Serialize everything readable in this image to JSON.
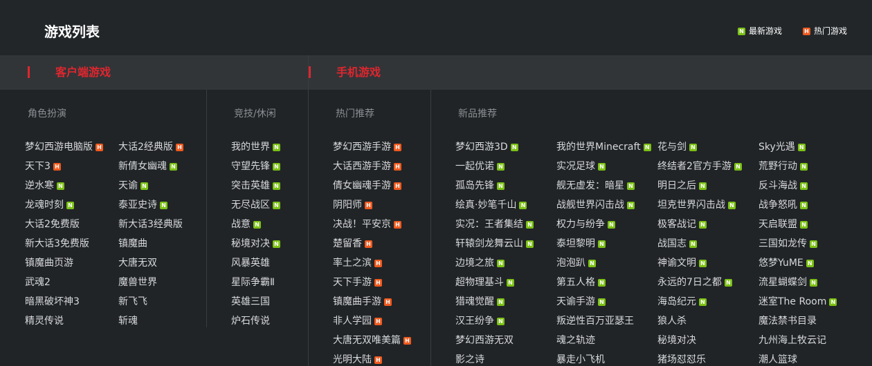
{
  "header": {
    "title": "游戏列表",
    "legend_new": "最新游戏",
    "legend_hot": "热门游戏",
    "badge_new": "N",
    "badge_hot": "H"
  },
  "categories": {
    "client": "客户端游戏",
    "mobile": "手机游戏"
  },
  "columns": [
    {
      "title": "角色扮演",
      "games": [
        {
          "name": "梦幻西游电脑版",
          "tag": "hot"
        },
        {
          "name": "天下3",
          "tag": "hot"
        },
        {
          "name": "逆水寒",
          "tag": "new"
        },
        {
          "name": "龙魂时刻",
          "tag": "new"
        },
        {
          "name": "大话2免费版",
          "tag": ""
        },
        {
          "name": "新大话3免费版",
          "tag": ""
        },
        {
          "name": "镇魔曲页游",
          "tag": ""
        },
        {
          "name": "武魂2",
          "tag": ""
        },
        {
          "name": "暗黑破坏神3",
          "tag": ""
        },
        {
          "name": "精灵传说",
          "tag": ""
        }
      ]
    },
    {
      "title": "",
      "games": [
        {
          "name": "大话2经典版",
          "tag": "hot"
        },
        {
          "name": "新倩女幽魂",
          "tag": "new"
        },
        {
          "name": "天谕",
          "tag": "new"
        },
        {
          "name": "泰亚史诗",
          "tag": "new"
        },
        {
          "name": "新大话3经典版",
          "tag": ""
        },
        {
          "name": "镇魔曲",
          "tag": ""
        },
        {
          "name": "大唐无双",
          "tag": ""
        },
        {
          "name": "魔兽世界",
          "tag": ""
        },
        {
          "name": "新飞飞",
          "tag": ""
        },
        {
          "name": "斩魂",
          "tag": ""
        }
      ]
    },
    {
      "title": "竞技/休闲",
      "games": [
        {
          "name": "我的世界",
          "tag": "new"
        },
        {
          "name": "守望先锋",
          "tag": "new"
        },
        {
          "name": "突击英雄",
          "tag": "new"
        },
        {
          "name": "无尽战区",
          "tag": "new"
        },
        {
          "name": "战意",
          "tag": "new"
        },
        {
          "name": "秘境对决",
          "tag": "new"
        },
        {
          "name": "风暴英雄",
          "tag": ""
        },
        {
          "name": "星际争霸Ⅱ",
          "tag": ""
        },
        {
          "name": "英雄三国",
          "tag": ""
        },
        {
          "name": "炉石传说",
          "tag": ""
        }
      ]
    },
    {
      "title": "热门推荐",
      "games": [
        {
          "name": "梦幻西游手游",
          "tag": "hot"
        },
        {
          "name": "大话西游手游",
          "tag": "hot"
        },
        {
          "name": "倩女幽魂手游",
          "tag": "hot"
        },
        {
          "name": "阴阳师",
          "tag": "hot"
        },
        {
          "name": "决战！平安京",
          "tag": "hot"
        },
        {
          "name": "楚留香",
          "tag": "hot"
        },
        {
          "name": "率土之滨",
          "tag": "hot"
        },
        {
          "name": "天下手游",
          "tag": "hot"
        },
        {
          "name": "镇魔曲手游",
          "tag": "hot"
        },
        {
          "name": "非人学园",
          "tag": "hot"
        },
        {
          "name": "大唐无双唯美篇",
          "tag": "hot"
        },
        {
          "name": "光明大陆",
          "tag": "hot"
        }
      ]
    },
    {
      "title": "新品推荐",
      "games": [
        {
          "name": "梦幻西游3D",
          "tag": "new"
        },
        {
          "name": "一起优诺",
          "tag": "new"
        },
        {
          "name": "孤岛先锋",
          "tag": "new"
        },
        {
          "name": "绘真·妙笔千山",
          "tag": "new"
        },
        {
          "name": "实况：王者集结",
          "tag": "new"
        },
        {
          "name": "轩辕剑龙舞云山",
          "tag": "new"
        },
        {
          "name": "边境之旅",
          "tag": "new"
        },
        {
          "name": "超物理基斗",
          "tag": "new"
        },
        {
          "name": "猎魂觉醒",
          "tag": "new"
        },
        {
          "name": "汉王纷争",
          "tag": "new"
        },
        {
          "name": "梦幻西游无双",
          "tag": ""
        },
        {
          "name": "影之诗",
          "tag": ""
        }
      ]
    },
    {
      "title": "",
      "games": [
        {
          "name": "我的世界Minecraft",
          "tag": "new"
        },
        {
          "name": "实况足球",
          "tag": "new"
        },
        {
          "name": "舰无虚发：暗星",
          "tag": "new"
        },
        {
          "name": "战舰世界闪击战",
          "tag": "new"
        },
        {
          "name": "权力与纷争",
          "tag": "new"
        },
        {
          "name": "泰坦黎明",
          "tag": "new"
        },
        {
          "name": "泡泡趴",
          "tag": "new"
        },
        {
          "name": "第五人格",
          "tag": "new"
        },
        {
          "name": "天谕手游",
          "tag": "new"
        },
        {
          "name": "叛逆性百万亚瑟王",
          "tag": ""
        },
        {
          "name": "魂之轨迹",
          "tag": ""
        },
        {
          "name": "暴走小飞机",
          "tag": ""
        }
      ]
    },
    {
      "title": "",
      "games": [
        {
          "name": "花与剑",
          "tag": "new"
        },
        {
          "name": "终结者2官方手游",
          "tag": "new"
        },
        {
          "name": "明日之后",
          "tag": "new"
        },
        {
          "name": "坦克世界闪击战",
          "tag": "new"
        },
        {
          "name": "极客战记",
          "tag": "new"
        },
        {
          "name": "战国志",
          "tag": "new"
        },
        {
          "name": "神谕文明",
          "tag": "new"
        },
        {
          "name": "永远的7日之都",
          "tag": "new"
        },
        {
          "name": "海岛纪元",
          "tag": "new"
        },
        {
          "name": "狼人杀",
          "tag": ""
        },
        {
          "name": "秘境对决",
          "tag": ""
        },
        {
          "name": "猪场怼怼乐",
          "tag": ""
        }
      ]
    },
    {
      "title": "",
      "games": [
        {
          "name": "Sky光遇",
          "tag": "new"
        },
        {
          "name": "荒野行动",
          "tag": "new"
        },
        {
          "name": "反斗海战",
          "tag": "new"
        },
        {
          "name": "战争怒吼",
          "tag": "new"
        },
        {
          "name": "天启联盟",
          "tag": "new"
        },
        {
          "name": "三国如龙传",
          "tag": "new"
        },
        {
          "name": "悠梦YuME",
          "tag": "new"
        },
        {
          "name": "流星蝴蝶剑",
          "tag": "new"
        },
        {
          "name": "迷室The Room",
          "tag": "new"
        },
        {
          "name": "魔法禁书目录",
          "tag": ""
        },
        {
          "name": "九州海上牧云记",
          "tag": ""
        },
        {
          "name": "潮人篮球",
          "tag": ""
        }
      ]
    }
  ]
}
